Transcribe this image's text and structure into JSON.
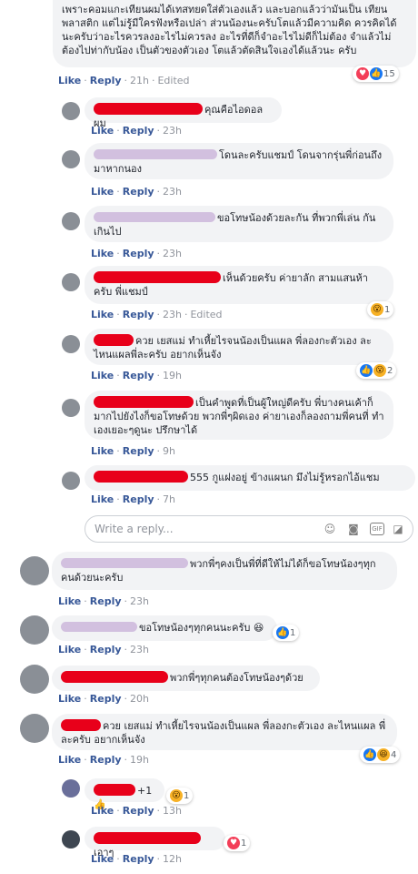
{
  "comments": [
    {
      "text": "เพราะคอมแกะเทียนผมได้เทสทยดใส่ตัวเองแล้ว และบอกแล้วว่ามันเป็น เทียนพลาสติก แต่ไม่รู้มีใครฟังหรือเปล่า ส่วนน้องนะครับโตแล้วมีความคิด ควรคิดได้นะครับว่าอะไรควรลงอะไรไม่ควรลง อะไรที่ดีก็จำอะไรไม่ดีก็ไม่ต้อง จำแล้วไม่ต้องไปท่ากับน้อง เป็นตัวของตัวเอง โตแล้วตัดสินใจเองได้แล้วนะ ครับ",
      "like": "Like",
      "reply": "Reply",
      "time": "21h",
      "edited": "Edited",
      "reactions": "15"
    },
    {
      "text": "คุณคือไอดอลผม",
      "like": "Like",
      "reply": "Reply",
      "time": "23h"
    },
    {
      "text": "โดนละครับแชมป์ โดนจากรุ่นพี่ก่อนถึง มาหากนอง",
      "like": "Like",
      "reply": "Reply",
      "time": "23h"
    },
    {
      "text": "ขอโทษน้องด้วยละกัน ที่พวกพี่เล่น กันเกินไป",
      "like": "Like",
      "reply": "Reply",
      "time": "23h"
    },
    {
      "text": "เห็นด้วยครับ ค่ายาลัก สามแสนห้าครับ พี่แชมป์",
      "like": "Like",
      "reply": "Reply",
      "time": "23h",
      "edited": "Edited",
      "reactions": "1"
    },
    {
      "text": "ควย เยสแม่ ทำเหี้ยไรจนน้องเป็นแผล พี่ลองกะตัวเอง ละ ไหนแผลพี่ละครับ อยากเห็นจัง",
      "like": "Like",
      "reply": "Reply",
      "time": "19h",
      "reactions": "2"
    },
    {
      "text": "เป็นคำพูดที่เป็นผู้ใหญ่ดีครับ พี่บางคนเค้าก็ มากไปยังไงก็ขอโทษด้วย พวกพี่ๆผิดเอง ค่ายาเองก็ลองถามพี่คนที่ ทำเองเยอะๆดูนะ ปรึกษาได้",
      "like": "Like",
      "reply": "Reply",
      "time": "9h"
    },
    {
      "text": "555 กูแฝงอยู่ ข้างแผนก มึงไม่รู้หรอกไอ้แชม",
      "like": "Like",
      "reply": "Reply",
      "time": "7h"
    },
    {
      "text": "พวกพี่ๆคงเป็นพี่ที่ดีให้ไม่ได้ก็ขอโทษน้องๆทุก คนด้วยนะครับ",
      "like": "Like",
      "reply": "Reply",
      "time": "23h"
    },
    {
      "text": "ขอโทษน้องๆทุกคนนะครับ",
      "like": "Like",
      "reply": "Reply",
      "time": "23h",
      "reactions": "1"
    },
    {
      "text": "พวกพี่ๆทุกคนต้องโทษน้องๆด้วย",
      "like": "Like",
      "reply": "Reply",
      "time": "20h"
    },
    {
      "text": "ควย เยสแม่ ทำเหี้ยไรจนน้องเป็นแผล พี่ลองกะตัวเอง ละไหนแผล พี่ละครับ อยากเห็นจัง",
      "like": "Like",
      "reply": "Reply",
      "time": "19h",
      "reactions": "4"
    },
    {
      "text": "+1",
      "like": "Like",
      "reply": "Reply",
      "time": "13h",
      "reactions": "1"
    },
    {
      "text": "เอาๆ",
      "like": "Like",
      "reply": "Reply",
      "time": "12h",
      "reactions": "1"
    }
  ],
  "reply_box": {
    "placeholder": "Write a reply..."
  },
  "icons": {
    "emoji": "emoji-icon",
    "camera": "camera-icon",
    "gif": "GIF",
    "sticker": "sticker-icon"
  },
  "colors": {
    "link": "#385898",
    "bubble": "#f2f3f5",
    "redaction": "#e8001a"
  }
}
